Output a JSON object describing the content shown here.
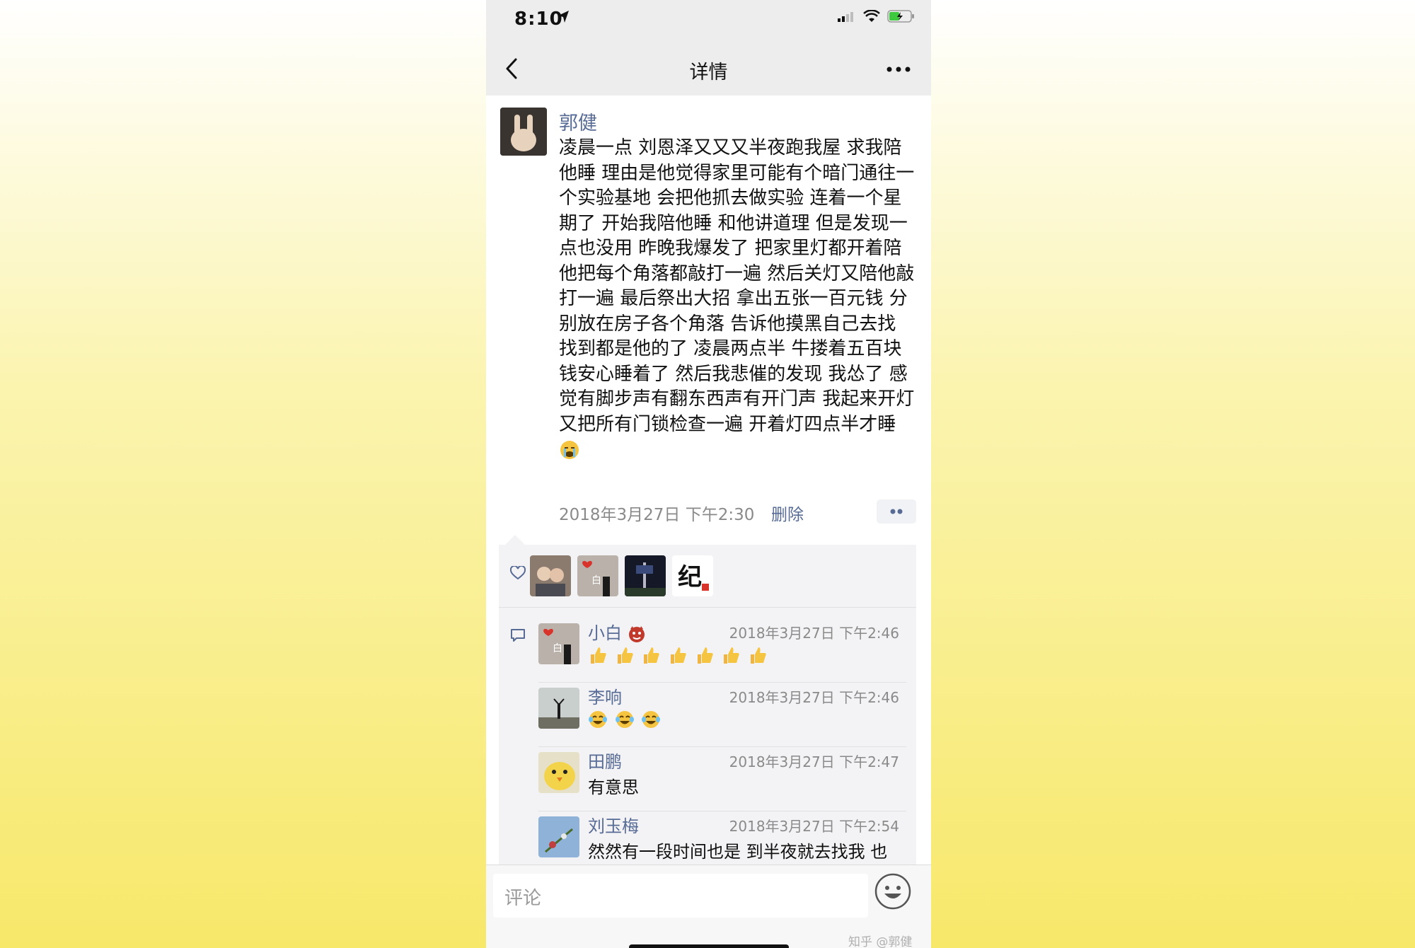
{
  "status": {
    "time": "8:10"
  },
  "nav": {
    "title": "详情"
  },
  "post": {
    "author": "郭健",
    "body": "凌晨一点 刘恩泽又又又半夜跑我屋 求我陪他睡 理由是他觉得家里可能有个暗门通往一个实验基地 会把他抓去做实验 连着一个星期了 开始我陪他睡 和他讲道理 但是发现一点也没用 昨晚我爆发了 把家里灯都开着陪他把每个角落都敲打一遍 然后关灯又陪他敲打一遍 最后祭出大招 拿出五张一百元钱 分别放在房子各个角落 告诉他摸黑自己去找 找到都是他的了 凌晨两点半 牛搂着五百块钱安心睡着了 然后我悲催的发现 我怂了 感觉有脚步声有翻东西声有开门声 我起来开灯又把所有门锁检查一遍 开着灯四点半才睡",
    "time": "2018年3月27日 下午2:30",
    "delete_label": "删除"
  },
  "likes": [
    "avatar-1",
    "avatar-2",
    "avatar-3",
    "avatar-4"
  ],
  "comments": [
    {
      "name": "小白",
      "time": "2018年3月27日 下午2:46",
      "text": "",
      "emoji": "thumbs-up",
      "emoji_count": 7
    },
    {
      "name": "李响",
      "time": "2018年3月27日 下午2:46",
      "text": "",
      "emoji": "laugh-cry",
      "emoji_count": 3
    },
    {
      "name": "田鹏",
      "time": "2018年3月27日 下午2:47",
      "text": "有意思"
    },
    {
      "name": "刘玉梅",
      "time": "2018年3月27日 下午2:54",
      "text": "然然有一段时间也是 到半夜就去找我 也"
    }
  ],
  "input": {
    "placeholder": "评论"
  },
  "watermark": "知乎 @郭健",
  "colors": {
    "link": "#576b95",
    "nav_bg": "#ededed",
    "comment_bg": "#f3f3f5"
  }
}
